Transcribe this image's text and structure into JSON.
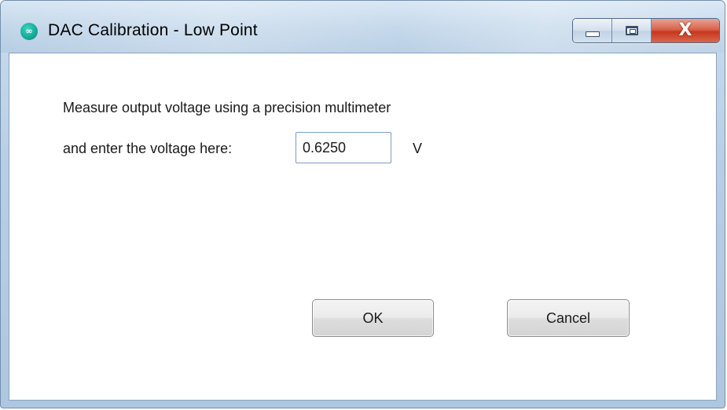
{
  "window": {
    "title": "DAC Calibration - Low Point",
    "app_icon": "maxim-logo-icon",
    "caption_buttons": {
      "minimize_icon": "minimize-icon",
      "maximize_icon": "maximize-icon",
      "close_icon": "close-icon",
      "close_glyph": "X"
    }
  },
  "form": {
    "instruction_line1": "Measure output voltage using a precision multimeter",
    "instruction_line2": "and enter the voltage here:",
    "voltage_value": "0.6250",
    "voltage_unit": "V"
  },
  "buttons": {
    "ok_label": "OK",
    "cancel_label": "Cancel"
  },
  "colors": {
    "titlebar": "#c3d7ea",
    "close_button": "#c6381d",
    "input_border": "#7a9cc6"
  }
}
